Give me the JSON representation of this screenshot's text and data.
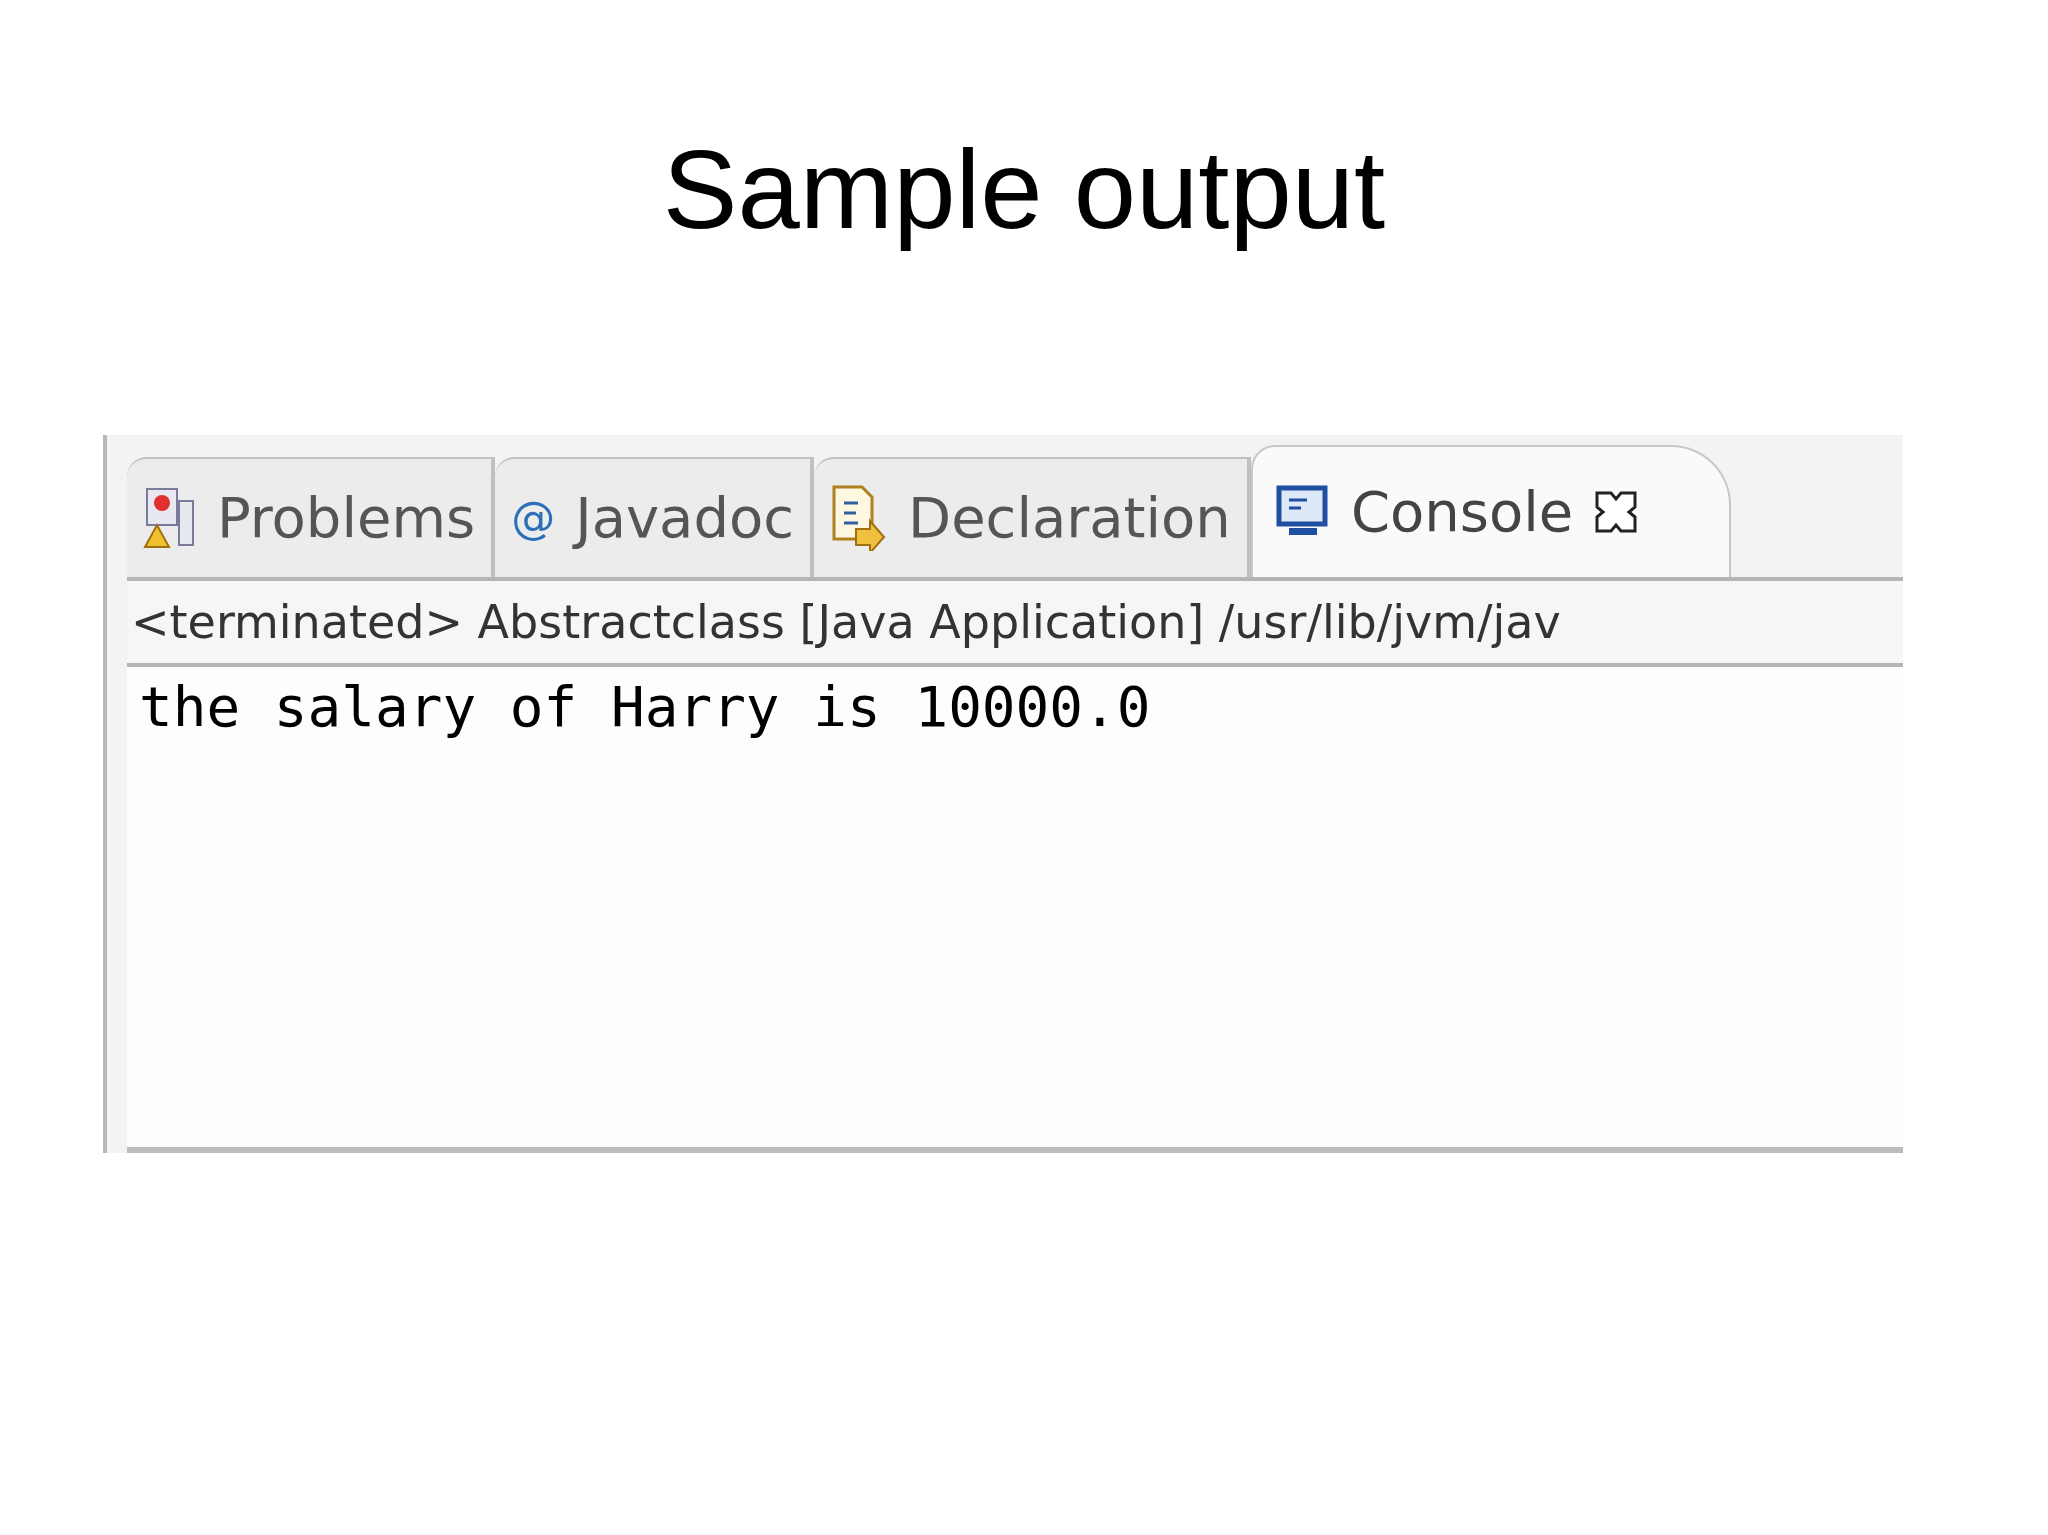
{
  "slide_title": "Sample output",
  "tabs": [
    {
      "label": "Problems",
      "kind": "problems",
      "selected": false
    },
    {
      "label": "Javadoc",
      "kind": "javadoc",
      "icon_glyph": "@",
      "selected": false
    },
    {
      "label": "Declaration",
      "kind": "declaration",
      "selected": false
    },
    {
      "label": "Console",
      "kind": "console",
      "selected": true,
      "closable": true
    }
  ],
  "console": {
    "status": "<terminated> Abstractclass [Java Application] /usr/lib/jvm/jav",
    "output": "the salary of Harry is 10000.0"
  }
}
